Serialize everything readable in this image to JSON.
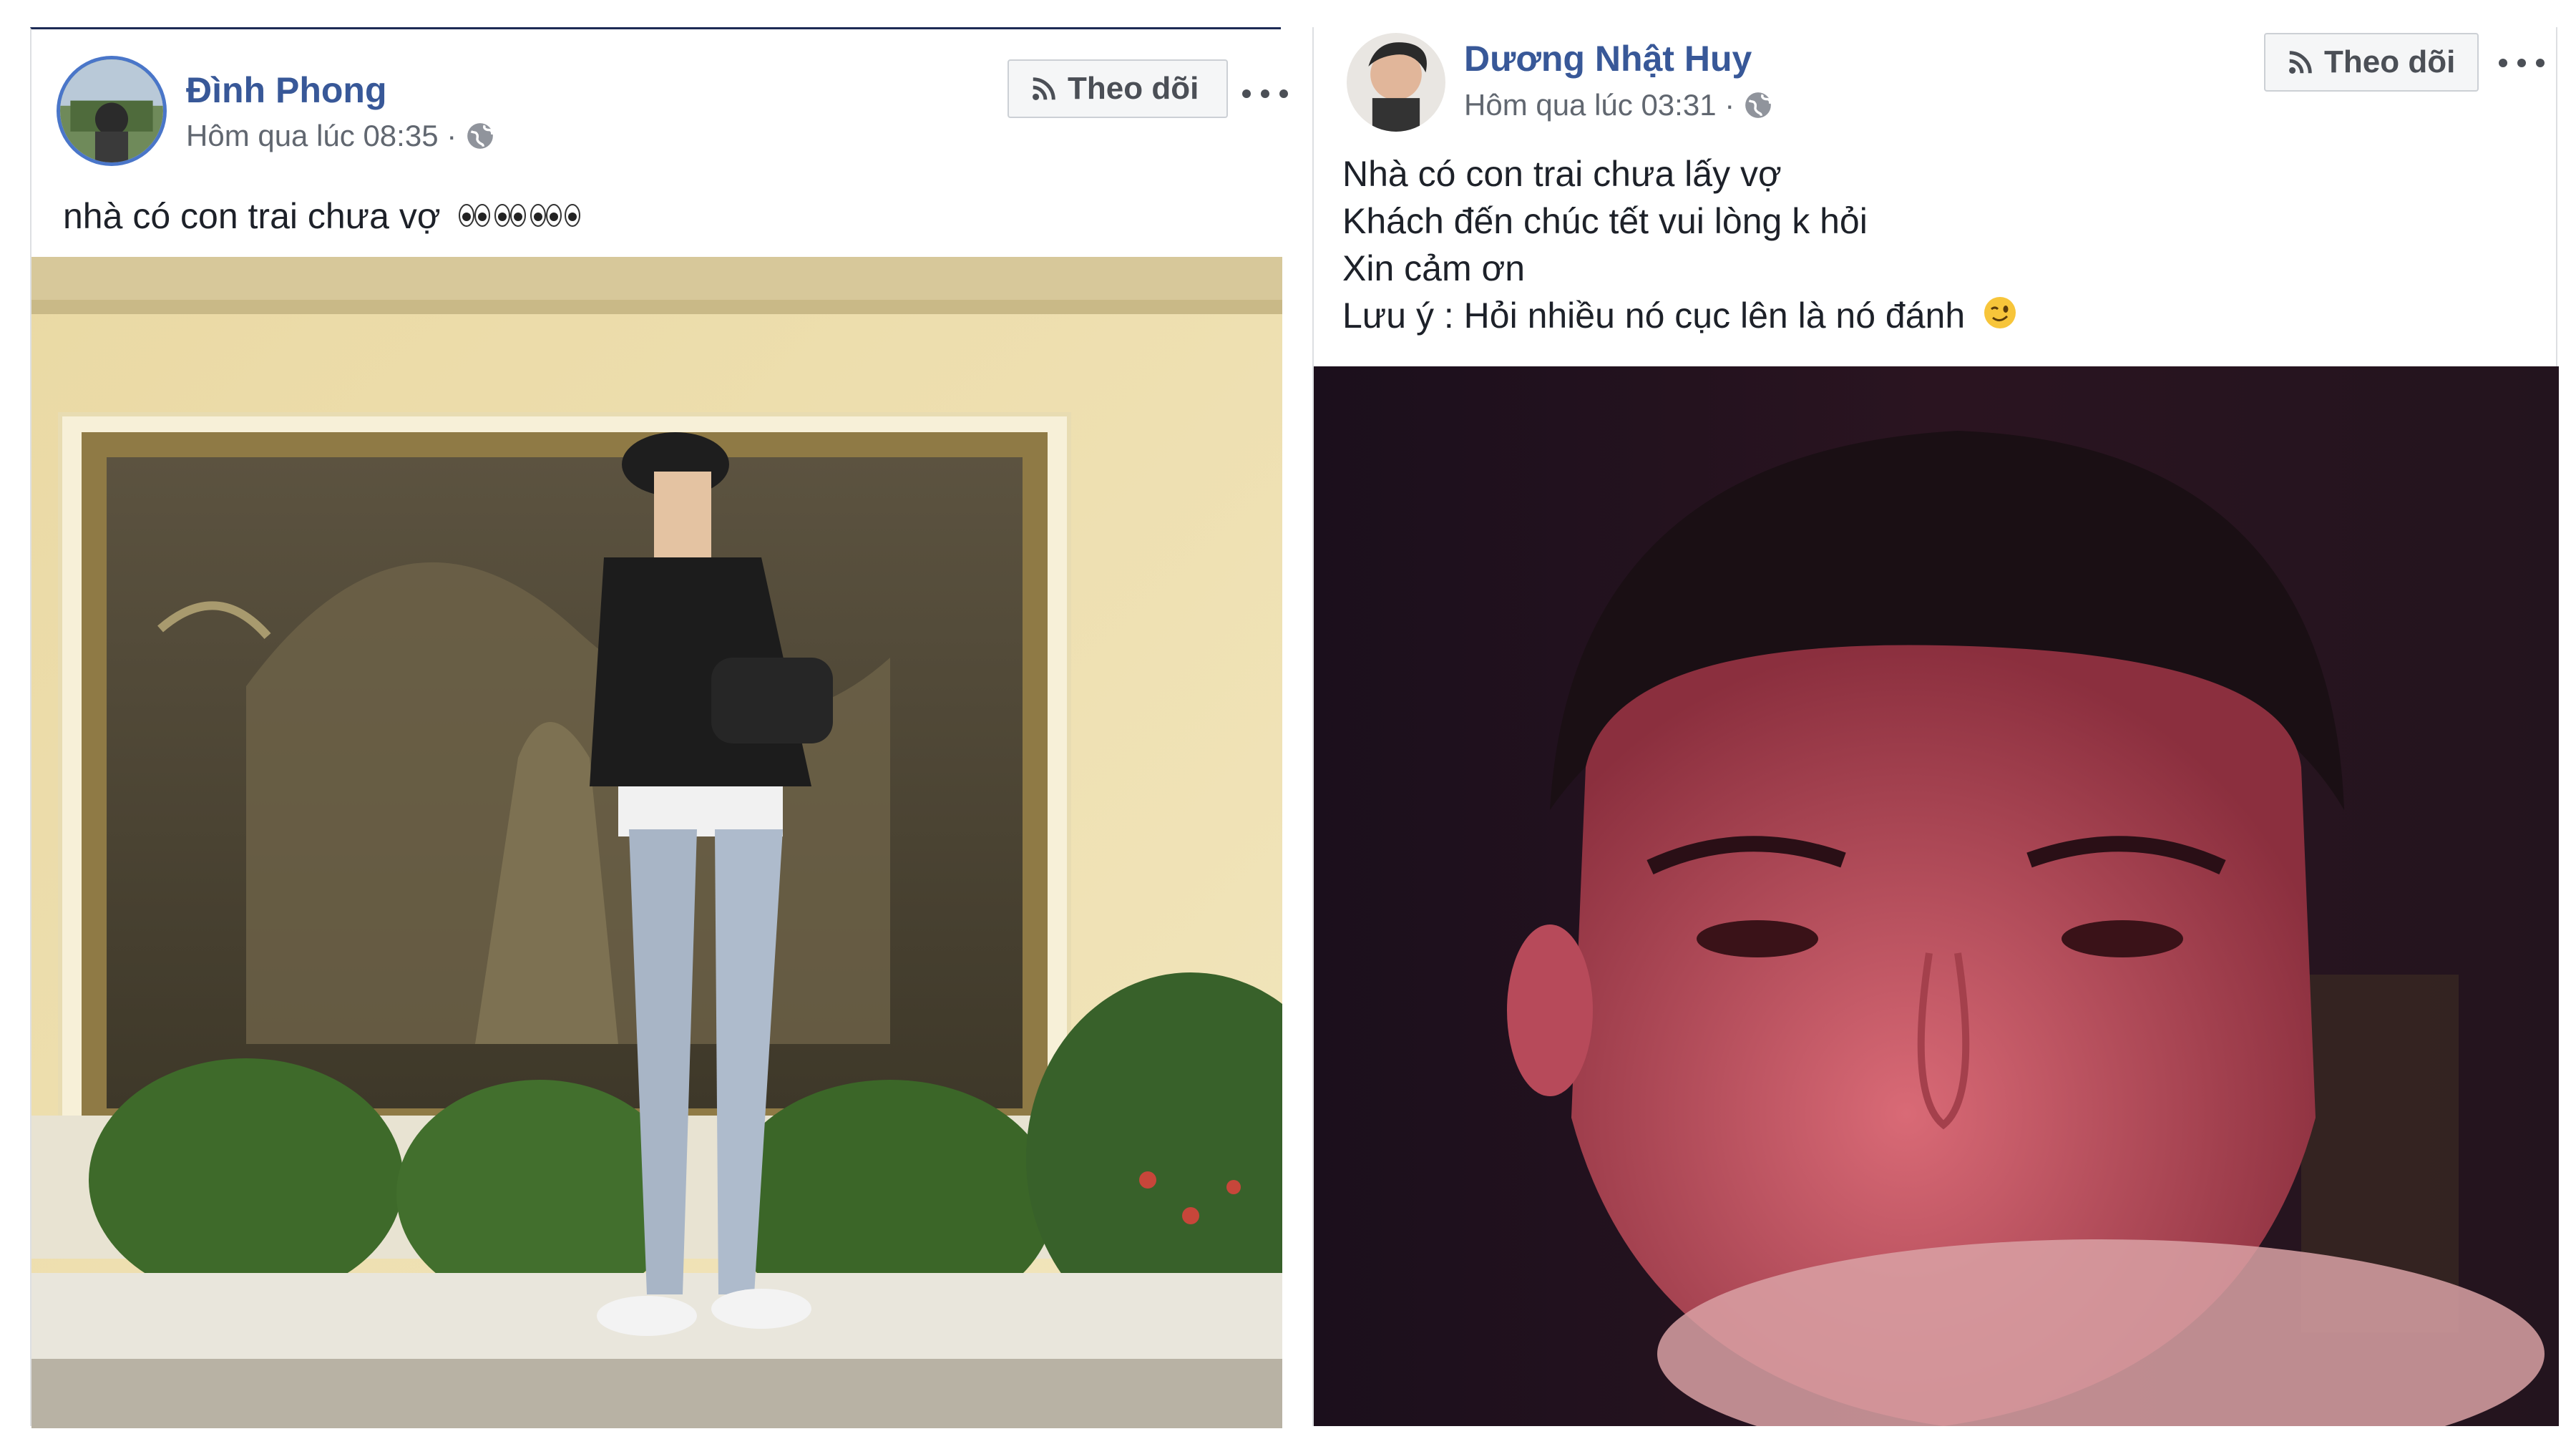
{
  "posts": [
    {
      "author": "Đình Phong",
      "meta": "Hôm qua lúc 08:35 ·",
      "follow_label": "Theo dõi",
      "text_lines": [
        "nhà có con trai chưa vợ"
      ],
      "privacy_icon": "globe-icon",
      "emoji": "eyes-emoji x6"
    },
    {
      "author": "Dương Nhật Huy",
      "meta": "Hôm qua lúc 03:31 ·",
      "follow_label": "Theo dõi",
      "text_lines": [
        "Nhà có con trai chưa lấy vợ",
        "Khách đến chúc tết vui lòng k hỏi",
        "Xin cảm ơn",
        "Lưu ý : Hỏi nhiều nó cục lên là nó đánh"
      ],
      "privacy_icon": "globe-icon",
      "emoji": "winking-face-emoji"
    }
  ],
  "colors": {
    "author_link": "#385898",
    "meta_text": "#616770",
    "body_text": "#1d2129",
    "button_bg": "#f5f6f7"
  }
}
